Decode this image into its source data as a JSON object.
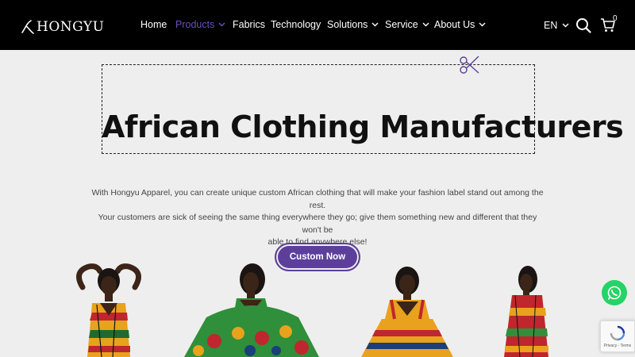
{
  "header": {
    "logo_text": "HONGYU",
    "nav": [
      {
        "label": "Home",
        "active": false,
        "dropdown": false
      },
      {
        "label": "Products",
        "active": true,
        "dropdown": true
      },
      {
        "label": "Fabrics",
        "active": false,
        "dropdown": false
      },
      {
        "label": "Technology",
        "active": false,
        "dropdown": false
      },
      {
        "label": "Solutions",
        "active": false,
        "dropdown": true
      },
      {
        "label": "Service",
        "active": false,
        "dropdown": true
      },
      {
        "label": "About Us",
        "active": false,
        "dropdown": true
      }
    ],
    "language": "EN",
    "cart_count": "0",
    "active_color": "#6a4fc1"
  },
  "hero": {
    "title": "African Clothing Manufacturers",
    "intro_line1": "With Hongyu Apparel, you can create unique custom African clothing that will make your fashion label stand out among the rest.",
    "intro_line2": "Your customers are sick of seeing the same thing everywhere they go; give them something new and different that they won't be",
    "intro_line3": "able to find anywhere else!",
    "cta_label": "Custom Now",
    "cta_color": "#5b3f9a"
  },
  "recaptcha": {
    "links": "Privacy - Terms"
  }
}
